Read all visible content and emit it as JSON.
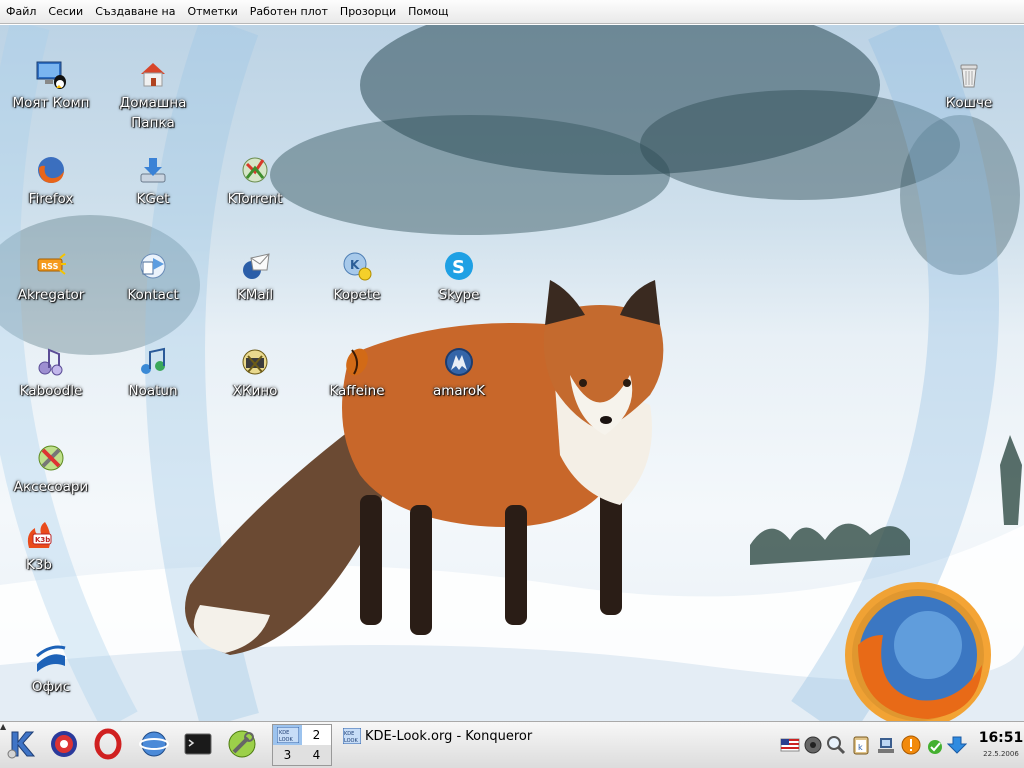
{
  "menubar": {
    "items": [
      "Файл",
      "Сесии",
      "Създаване на",
      "Отметки",
      "Работен плот",
      "Прозорци",
      "Помощ"
    ]
  },
  "desktop": {
    "icons": {
      "my_computer": {
        "label": "Моят Комп",
        "icon": "computer-icon"
      },
      "home": {
        "label": "Домашна Папка",
        "icon": "home-folder-icon"
      },
      "trash": {
        "label": "Кошче",
        "icon": "trash-icon"
      },
      "firefox": {
        "label": "Firefox",
        "icon": "firefox-icon"
      },
      "kget": {
        "label": "KGet",
        "icon": "download-icon"
      },
      "ktorrent": {
        "label": "KTorrent",
        "icon": "torrent-icon"
      },
      "akregator": {
        "label": "Akregator",
        "icon": "rss-icon"
      },
      "kontact": {
        "label": "Kontact",
        "icon": "kontact-icon"
      },
      "kmail": {
        "label": "KMail",
        "icon": "mail-icon"
      },
      "kopete": {
        "label": "Kopete",
        "icon": "chat-icon"
      },
      "skype": {
        "label": "Skype",
        "icon": "skype-icon"
      },
      "kaboodle": {
        "label": "Kaboodle",
        "icon": "media-player-icon"
      },
      "noatun": {
        "label": "Noatun",
        "icon": "music-icon"
      },
      "xkino": {
        "label": "ХКино",
        "icon": "film-icon"
      },
      "kaffeine": {
        "label": "Kaffeine",
        "icon": "kaffeine-icon"
      },
      "amarok": {
        "label": "amaroK",
        "icon": "amarok-icon"
      },
      "accessories": {
        "label": "Аксесоари",
        "icon": "tools-icon"
      },
      "k3b": {
        "label": "K3b",
        "icon": "cd-burn-icon"
      },
      "office": {
        "label": "Офис",
        "icon": "office-icon"
      }
    }
  },
  "panel": {
    "launchers": [
      "kde-menu-icon",
      "cd-player-icon",
      "opera-icon",
      "browser-icon",
      "terminal-icon",
      "tools-icon"
    ],
    "pager": {
      "desktops": [
        "1",
        "2",
        "3",
        "4"
      ]
    },
    "taskbar": {
      "title": "KDE-Look.org - Konqueror",
      "icon_text": "KDE LOOK"
    },
    "tray": [
      "keyboard-layout-icon",
      "speaker-icon",
      "search-icon",
      "klipper-icon",
      "network-icon",
      "update-warning-icon",
      "check-icon",
      "download-arrow-icon"
    ],
    "clock": {
      "time": "16:51",
      "date": "22.5.2006"
    }
  },
  "colors": {
    "accent": "#1e6fd0",
    "fox": "#c8672a"
  }
}
